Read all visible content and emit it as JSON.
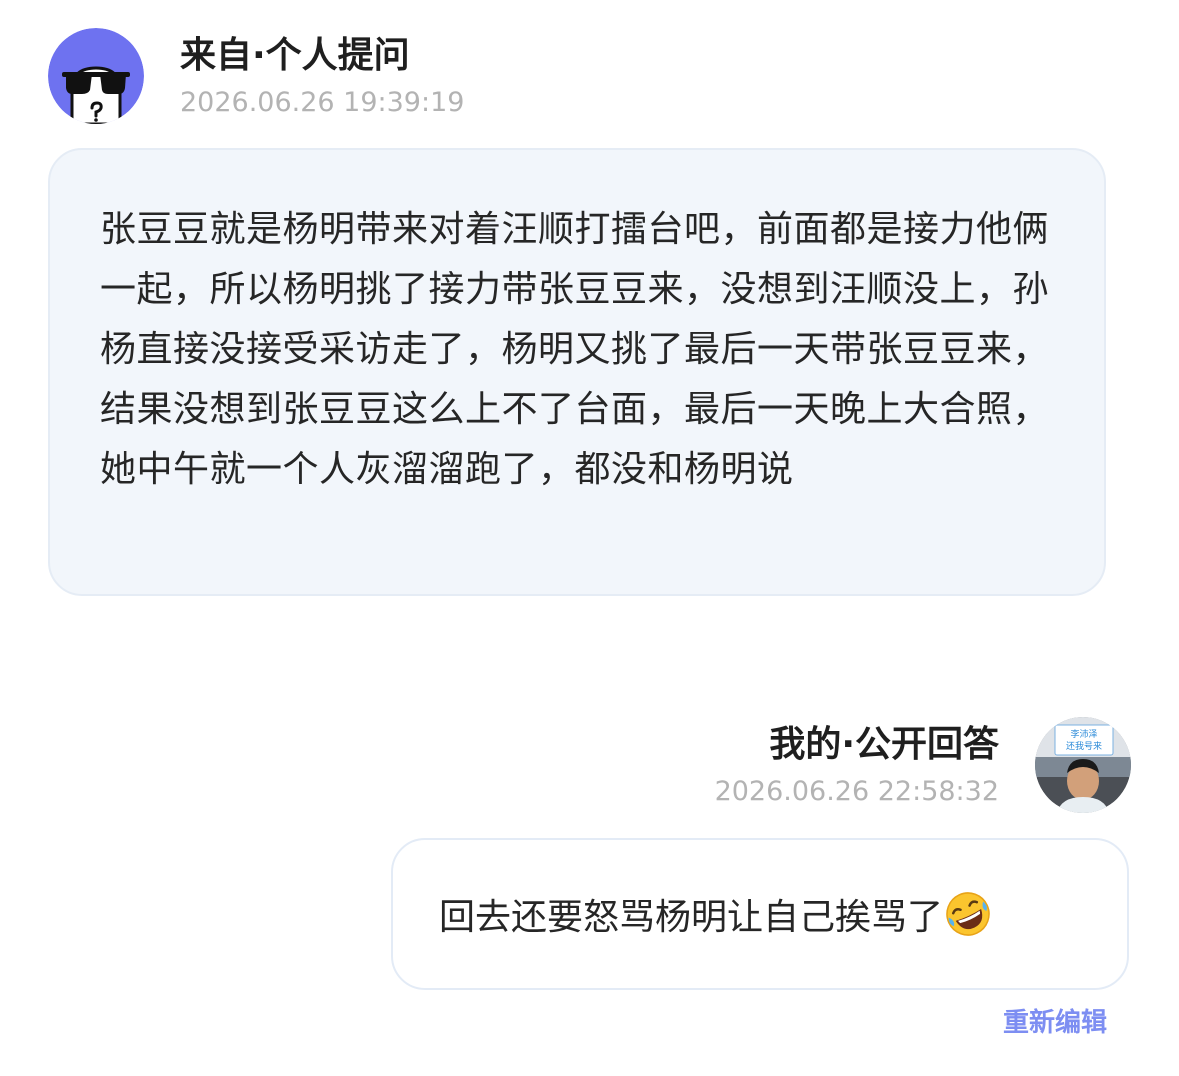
{
  "question": {
    "header_title": "来自·个人提问",
    "timestamp": "2026.06.26 19:39:19",
    "avatar_icon": "sunglasses-ghost-icon",
    "avatar_color": "#6e72f0",
    "text": "张豆豆就是杨明带来对着汪顺打擂台吧，前面都是接力他俩一起，所以杨明挑了接力带张豆豆来，没想到汪顺没上，孙杨直接没接受采访走了，杨明又挑了最后一天带张豆豆来，结果没想到张豆豆这么上不了台面，最后一天晚上大合照，她中午就一个人灰溜溜跑了，都没和杨明说"
  },
  "answer": {
    "header_title": "我的·公开回答",
    "timestamp": "2026.06.26 22:58:32",
    "avatar_sign_line1": "李沛泽",
    "avatar_sign_line2": "还我号来",
    "text": "回去还要怒骂杨明让自己挨骂了",
    "emoji_icon": "rolling-on-floor-laughing-icon",
    "edit_label": "重新编辑"
  },
  "colors": {
    "bubble_bg": "#f2f6fb",
    "timestamp": "#b3b3b3",
    "accent_link": "#7d8ef2"
  }
}
